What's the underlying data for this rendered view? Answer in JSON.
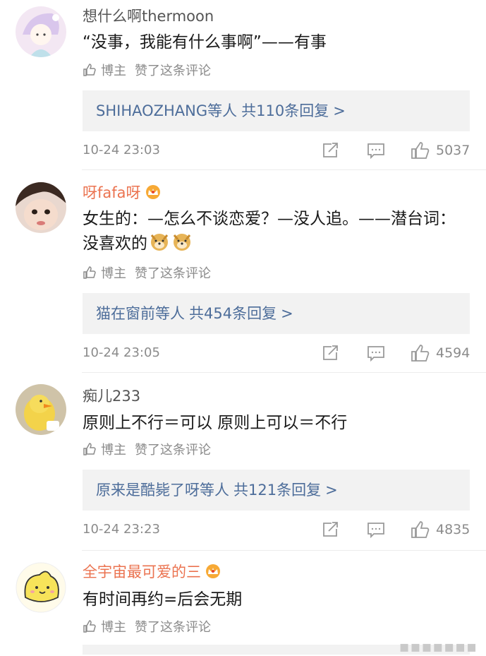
{
  "actions": {
    "share_icon": "share-icon",
    "comment_icon": "comment-icon",
    "like_icon": "like-icon"
  },
  "liked_label": {
    "blogger": "博主",
    "text": "赞了这条评论"
  },
  "comments": [
    {
      "username": "想什么啊thermoon",
      "content": "“没事，我能有什么事啊”——有事",
      "replies": {
        "who": "SHIHAOZHANG等人",
        "tail": "共110条回复",
        "arrow": ">"
      },
      "time": "10-24 23:03",
      "likes": "5037"
    },
    {
      "username": "呀fafa呀",
      "content": "女生的：—怎么不谈恋爱？—没人追。——潜台词：没喜欢的",
      "replies": {
        "who": "猫在窗前等人",
        "tail": "共454条回复",
        "arrow": ">"
      },
      "time": "10-24 23:05",
      "likes": "4594"
    },
    {
      "username": "痴儿233",
      "content": "原则上不行＝可以  原则上可以＝不行",
      "replies": {
        "who": "原来是酷毙了呀等人",
        "tail": "共121条回复",
        "arrow": ">"
      },
      "time": "10-24 23:23",
      "likes": "4835"
    },
    {
      "username": "全宇宙最可爱的三",
      "content": "有时间再约=后会无期"
    }
  ],
  "colors": {
    "link": "#4d6d9a",
    "vip_name": "#eb7350",
    "meta": "#8b8b8b",
    "reply_bg": "#f2f2f2"
  }
}
